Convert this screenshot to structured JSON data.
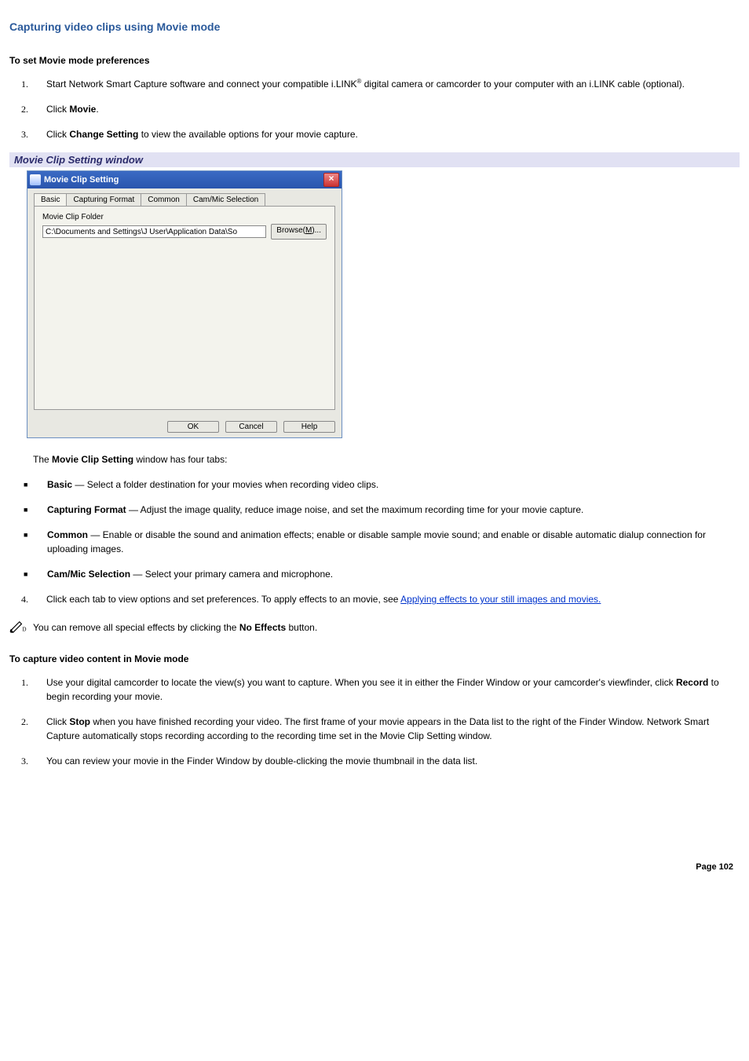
{
  "page_title": "Capturing video clips using Movie mode",
  "section1_heading": "To set Movie mode preferences",
  "steps1": {
    "s1_pre": "Start Network Smart Capture software and connect your compatible i.LINK",
    "s1_reg": "®",
    "s1_post": " digital camera or camcorder to your computer with an i.LINK cable (optional).",
    "s2_pre": "Click ",
    "s2_b": "Movie",
    "s2_post": ".",
    "s3_pre": "Click ",
    "s3_b": "Change Setting",
    "s3_post": " to view the available options for your movie capture."
  },
  "caption_bar": "Movie Clip Setting window",
  "dialog": {
    "title": "Movie Clip Setting",
    "close": "×",
    "tabs": {
      "basic": "Basic",
      "capfmt": "Capturing Format",
      "common": "Common",
      "cammic": "Cam/Mic Selection"
    },
    "folder_label": "Movie Clip Folder",
    "folder_value": "C:\\Documents and Settings\\J User\\Application Data\\So",
    "browse": "Browse(M)...",
    "ok": "OK",
    "cancel": "Cancel",
    "help": "Help"
  },
  "tabs_intro_pre": "The ",
  "tabs_intro_b": "Movie Clip Setting",
  "tabs_intro_post": " window has four tabs:",
  "bullets": {
    "b1_b": "Basic",
    "b1_rest": " — Select a folder destination for your movies when recording video clips.",
    "b2_b": "Capturing Format",
    "b2_rest": " — Adjust the image quality, reduce image noise, and set the maximum recording time for your movie capture.",
    "b3_b": "Common",
    "b3_rest": " — Enable or disable the sound and animation effects; enable or disable sample movie sound; and enable or disable automatic dialup connection for uploading images.",
    "b4_b": "Cam/Mic Selection",
    "b4_rest": " — Select your primary camera and microphone."
  },
  "step4_pre": "Click each tab to view options and set preferences. To apply effects to an movie, see ",
  "step4_link": "Applying effects to your still images and movies.",
  "note_pre": "You can remove all special effects by clicking the ",
  "note_b": "No Effects",
  "note_post": " button.",
  "section2_heading": "To capture video content in Movie mode",
  "steps2": {
    "s1_pre": "Use your digital camcorder to locate the view(s) you want to capture. When you see it in either the Finder Window or your camcorder's viewfinder, click ",
    "s1_b": "Record",
    "s1_post": " to begin recording your movie.",
    "s2_pre": "Click ",
    "s2_b": "Stop",
    "s2_post": " when you have finished recording your video. The first frame of your movie appears in the Data list to the right of the Finder Window. Network Smart Capture automatically stops recording according to the recording time set in the Movie Clip Setting window.",
    "s3": "You can review your movie in the Finder Window by double-clicking the movie thumbnail in the data list."
  },
  "page_num": "Page 102"
}
